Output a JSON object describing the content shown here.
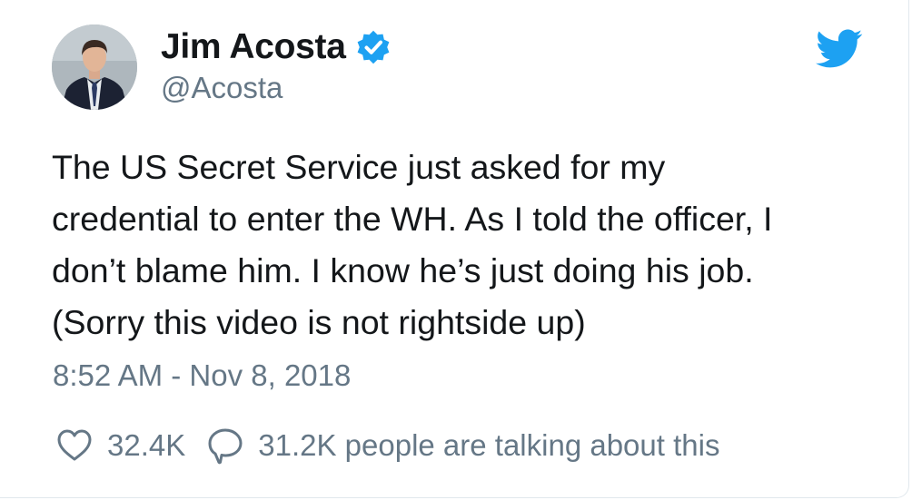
{
  "author": {
    "name": "Jim Acosta",
    "handle": "@Acosta",
    "verified": true
  },
  "tweet": {
    "text": "The US Secret Service just asked for my\ncredential to enter the WH. As I told the officer, I\ndon’t blame him. I know he’s just doing his job.\n(Sorry this video is not rightside up)",
    "timestamp": "8:52 AM - Nov 8, 2018"
  },
  "stats": {
    "likes": "32.4K",
    "talking": "31.2K people are talking about this"
  },
  "icons": {
    "verified": "verified-badge-icon",
    "brand": "twitter-bird-icon",
    "like": "heart-icon",
    "comment": "speech-bubble-icon"
  },
  "colors": {
    "brand": "#1da1f2",
    "text": "#14171a",
    "muted": "#657786"
  }
}
